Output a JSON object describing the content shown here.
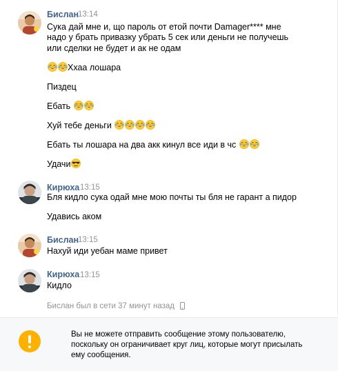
{
  "conversation": {
    "groups": [
      {
        "author": "Бислан",
        "time": "13:14",
        "messages": [
          "Сука дай мне и, що пароль от етой почти Damager**** мне",
          "надо у брать привазку убрать 5 сек или деньги не получешь",
          "или сделки не будет и ак не одам",
          "Ххаа лошара",
          "Пиздец",
          "Ебать",
          "Хуй тебе деньги",
          "Ебать ты лошара на два акк кинул все иди в чс",
          "Удачи"
        ]
      },
      {
        "author": "Кирюха",
        "time": "13:15",
        "messages": [
          "Бля кидло сука одай мне мою почты ты бля не гарант а пидор",
          "Удавись аком"
        ]
      },
      {
        "author": "Бислан",
        "time": "13:15",
        "messages": [
          "Нахуй иди уебан маме привет"
        ]
      },
      {
        "author": "Кирюха",
        "time": "13:15",
        "messages": [
          "Кидло"
        ]
      }
    ]
  },
  "status": {
    "last_seen": "Бислан был в сети 37 минут назад",
    "icon": "mobile-phone-icon"
  },
  "notice": {
    "icon": "warning-icon",
    "line1": "Вы не можете отправить сообщение этому пользователю,",
    "line2": "поскольку он ограничивает круг лиц, которые могут присылать",
    "line3": "ему сообщения."
  },
  "colors": {
    "author_name": "#42648b",
    "timestamp": "#939393",
    "notice_background": "#f7f8fa",
    "warning": "#ffb100"
  }
}
